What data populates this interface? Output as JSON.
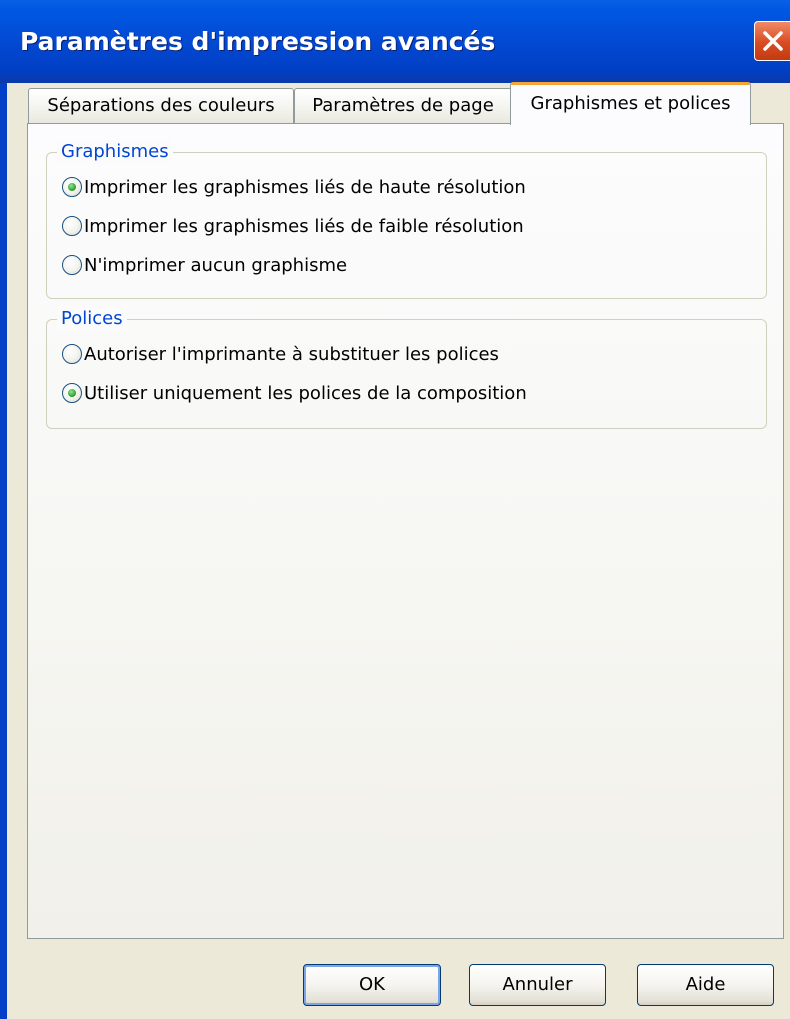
{
  "window": {
    "title": "Paramètres d'impression avancés",
    "close_icon": "close-icon"
  },
  "tabs": [
    {
      "label": "Séparations des couleurs",
      "active": false
    },
    {
      "label": "Paramètres de page",
      "active": false
    },
    {
      "label": "Graphismes et polices",
      "active": true
    }
  ],
  "graphismes": {
    "legend": "Graphismes",
    "options": [
      {
        "label": "Imprimer les graphismes liés de haute résolution",
        "checked": true
      },
      {
        "label": "Imprimer les graphismes liés de faible résolution",
        "checked": false
      },
      {
        "label": "N'imprimer aucun graphisme",
        "checked": false
      }
    ]
  },
  "polices": {
    "legend": "Polices",
    "options": [
      {
        "label": "Autoriser l'imprimante à substituer les polices",
        "checked": false
      },
      {
        "label": "Utiliser uniquement les polices de la composition",
        "checked": true
      }
    ]
  },
  "buttons": {
    "ok": "OK",
    "cancel": "Annuler",
    "help": "Aide"
  },
  "colors": {
    "titlebar": "#0349d3",
    "close": "#d84b23",
    "legend": "#0046d5",
    "active_tab_accent": "#f5a43a",
    "radio_dot": "#2a9a2a"
  }
}
